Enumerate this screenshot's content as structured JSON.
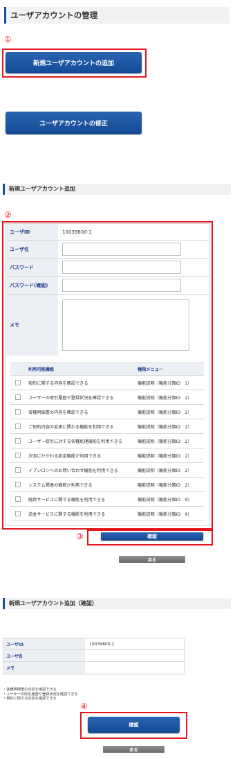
{
  "page": {
    "title": "ユーザアカウントの管理"
  },
  "markers": {
    "m1": "①",
    "m2": "②",
    "m3": "③",
    "m4": "④"
  },
  "buttons": {
    "add": "新規ユーザアカウントの追加",
    "edit": "ユーザアカウントの修正",
    "confirm1": "確認",
    "back1": "戻る",
    "confirm2": "確認",
    "back2": "戻る"
  },
  "add_form": {
    "title": "新規ユーザアカウント追加",
    "fields": {
      "user_id_label": "ユーザID",
      "user_id_value": "10039800-1",
      "user_name_label": "ユーザ名",
      "password_label": "パスワード",
      "password_confirm_label": "パスワード(確認)",
      "memo_label": "メモ"
    },
    "table": {
      "headers": [
        "利用可能機能",
        "権限メニュー"
      ],
      "rows": [
        [
          "契約に関する内容を確認できる",
          "機能説明（機能分類ID　1）"
        ],
        [
          "ユーザーの取引履歴や登録状況を確認できる",
          "機能説明（機能分類ID　2）"
        ],
        [
          "各種明細書の内容を確認できる",
          "機能説明（機能分類ID　2）"
        ],
        [
          "ご契約内容の変更に関わる機能を利用できる",
          "機能説明（機能分類ID　2）"
        ],
        [
          "ユーザー取引に対する各種処理機能を利用できる",
          "機能説明（機能分類ID　2）"
        ],
        [
          "決済にかかわる設定機能が利用できる",
          "機能説明（機能分類ID　2）"
        ],
        [
          "イプシロンへのお問い合わせ機能を利用できる",
          "機能説明（機能分類ID　2）"
        ],
        [
          "システム関連の機能が利用できる",
          "機能説明（機能分類ID　2）"
        ],
        [
          "融資サービスに関する機能を利用できる",
          "機能説明（機能分類ID　9）"
        ],
        [
          "送金サービスに関する機能を利用できる",
          "機能説明（機能分類ID　9）"
        ]
      ]
    }
  },
  "confirm_section": {
    "title": "新規ユーザアカウント追加（確認）",
    "rows": [
      {
        "label": "ユーザID",
        "value": "10039800-1"
      },
      {
        "label": "ユーザ名",
        "value": ""
      },
      {
        "label": "メモ",
        "value": ""
      }
    ],
    "notes": [
      "・各種明細書の内容を確認できる",
      "・ユーザーの取引履歴や登録状況を確認できる",
      "・契約に関する内容を確認できる"
    ]
  }
}
